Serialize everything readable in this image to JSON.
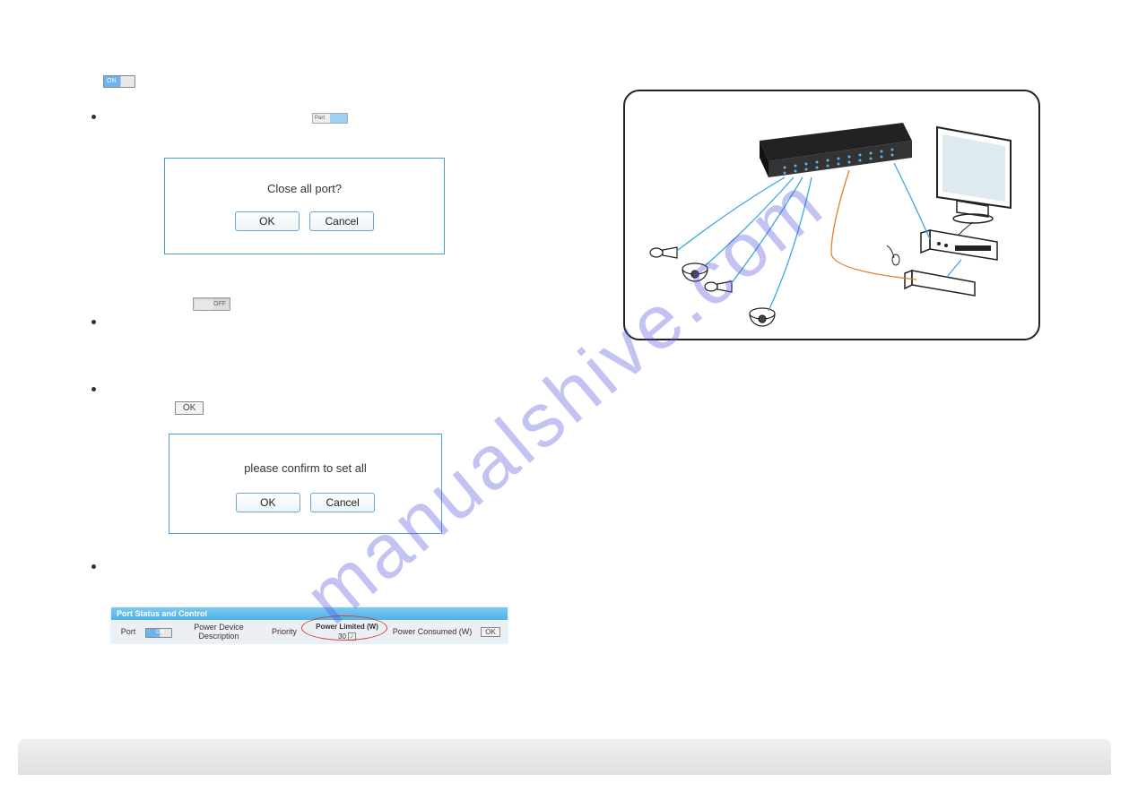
{
  "watermark": "manualshive.com",
  "toggle_on_label": "ON",
  "toggle_off_label": "OFF",
  "mini_toggle_left": "Part",
  "dialog1": {
    "message": "Close all port?",
    "ok": "OK",
    "cancel": "Cancel"
  },
  "dialog2": {
    "message": "please confirm to set all",
    "ok": "OK",
    "cancel": "Cancel"
  },
  "ok_button": "OK",
  "table": {
    "title": "Port Status and Control",
    "headers": {
      "port": "Port",
      "desc": "Power Device Description",
      "priority": "Priority",
      "power_limited": "Power Limited (W)",
      "power_consumed": "Power Consumed (W)"
    },
    "power_limited_value": "30",
    "checkbox_mark": "✓",
    "ok": "OK",
    "port_toggle": "ON"
  }
}
